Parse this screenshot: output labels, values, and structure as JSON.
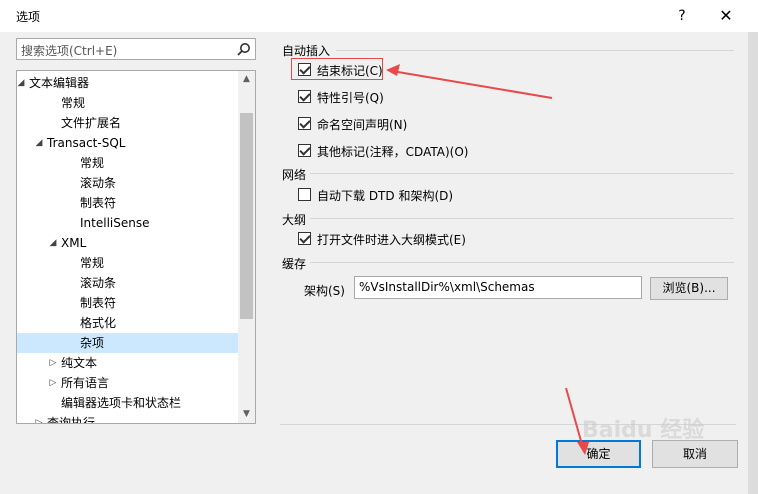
{
  "window": {
    "title": "选项",
    "help": "?",
    "close": "✕"
  },
  "search": {
    "placeholder": "搜索选项(Ctrl+E)"
  },
  "tree": {
    "items": [
      {
        "label": "文本编辑器",
        "arrow": "◢"
      },
      {
        "label": "常规"
      },
      {
        "label": "文件扩展名"
      },
      {
        "label": "Transact-SQL",
        "arrow": "◢"
      },
      {
        "label": "常规"
      },
      {
        "label": "滚动条"
      },
      {
        "label": "制表符"
      },
      {
        "label": "IntelliSense"
      },
      {
        "label": "XML",
        "arrow": "◢"
      },
      {
        "label": "常规"
      },
      {
        "label": "滚动条"
      },
      {
        "label": "制表符"
      },
      {
        "label": "格式化"
      },
      {
        "label": "杂项",
        "selected": true
      },
      {
        "label": "纯文本",
        "arrow": "▷"
      },
      {
        "label": "所有语言",
        "arrow": "▷"
      },
      {
        "label": "编辑器选项卡和状态栏"
      },
      {
        "label": "查询执行",
        "arrow": "▷"
      }
    ]
  },
  "groups": {
    "auto_insert": {
      "title": "自动插入",
      "items": [
        {
          "label": "结束标记(C)",
          "checked": true
        },
        {
          "label": "特性引号(Q)",
          "checked": true
        },
        {
          "label": "命名空间声明(N)",
          "checked": true
        },
        {
          "label": "其他标记(注释，CDATA)(O)",
          "checked": true
        }
      ]
    },
    "network": {
      "title": "网络",
      "items": [
        {
          "label": "自动下载 DTD 和架构(D)",
          "checked": false
        }
      ]
    },
    "outline": {
      "title": "大纲",
      "items": [
        {
          "label": "打开文件时进入大纲模式(E)",
          "checked": true
        }
      ]
    },
    "cache": {
      "title": "缓存",
      "schema_label": "架构(S)",
      "schema_value": "%VsInstallDir%\\xml\\Schemas",
      "browse_label": "浏览(B)..."
    }
  },
  "footer": {
    "ok_label": "确定",
    "cancel_label": "取消"
  },
  "watermark": "Baidu 经验",
  "colors": {
    "accent": "#0078d7",
    "selection": "#cce8ff",
    "annotation": "#e64a4a"
  }
}
